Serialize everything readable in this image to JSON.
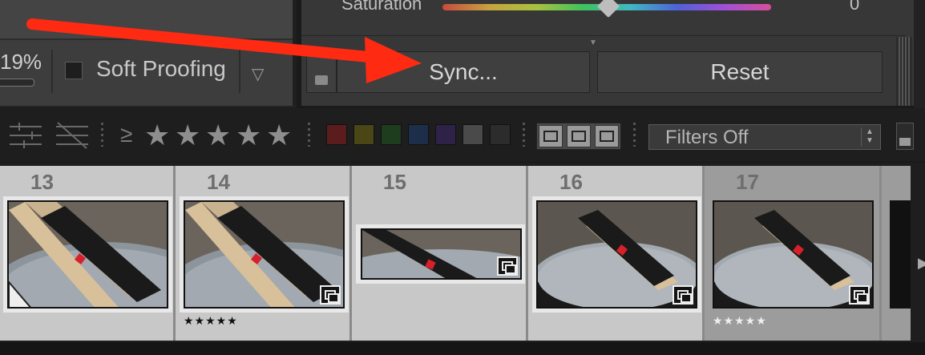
{
  "toolbar": {
    "zoom_text": "19%",
    "soft_proofing_label": "Soft Proofing",
    "dropdown_glyph": "▽"
  },
  "develop_panel": {
    "saturation_label": "Saturation",
    "saturation_value": "0",
    "sync_label": "Sync...",
    "reset_label": "Reset"
  },
  "filter_bar": {
    "rating_operator": "≥",
    "stars": [
      "★",
      "★",
      "★",
      "★",
      "★"
    ],
    "color_labels": [
      {
        "name": "red",
        "color": "#5a1c1c"
      },
      {
        "name": "yellow",
        "color": "#4a4616"
      },
      {
        "name": "green",
        "color": "#1e3c1e"
      },
      {
        "name": "blue",
        "color": "#1c2e4a"
      },
      {
        "name": "purple",
        "color": "#2e2248"
      },
      {
        "name": "gray",
        "color": "#4a4a4a"
      },
      {
        "name": "none",
        "color": "#2c2c2c"
      }
    ],
    "filters_label": "Filters Off"
  },
  "filmstrip": {
    "cells": [
      {
        "number": "13",
        "rating": "",
        "selected": false
      },
      {
        "number": "14",
        "rating": "★★★★★",
        "selected": false
      },
      {
        "number": "15",
        "rating": "",
        "selected": false
      },
      {
        "number": "16",
        "rating": "",
        "selected": false
      },
      {
        "number": "17",
        "rating": "★★★★★",
        "selected": true
      }
    ]
  },
  "accent_colors": {
    "annotation_arrow": "#ff2a12",
    "panel_bg": "#373737"
  }
}
